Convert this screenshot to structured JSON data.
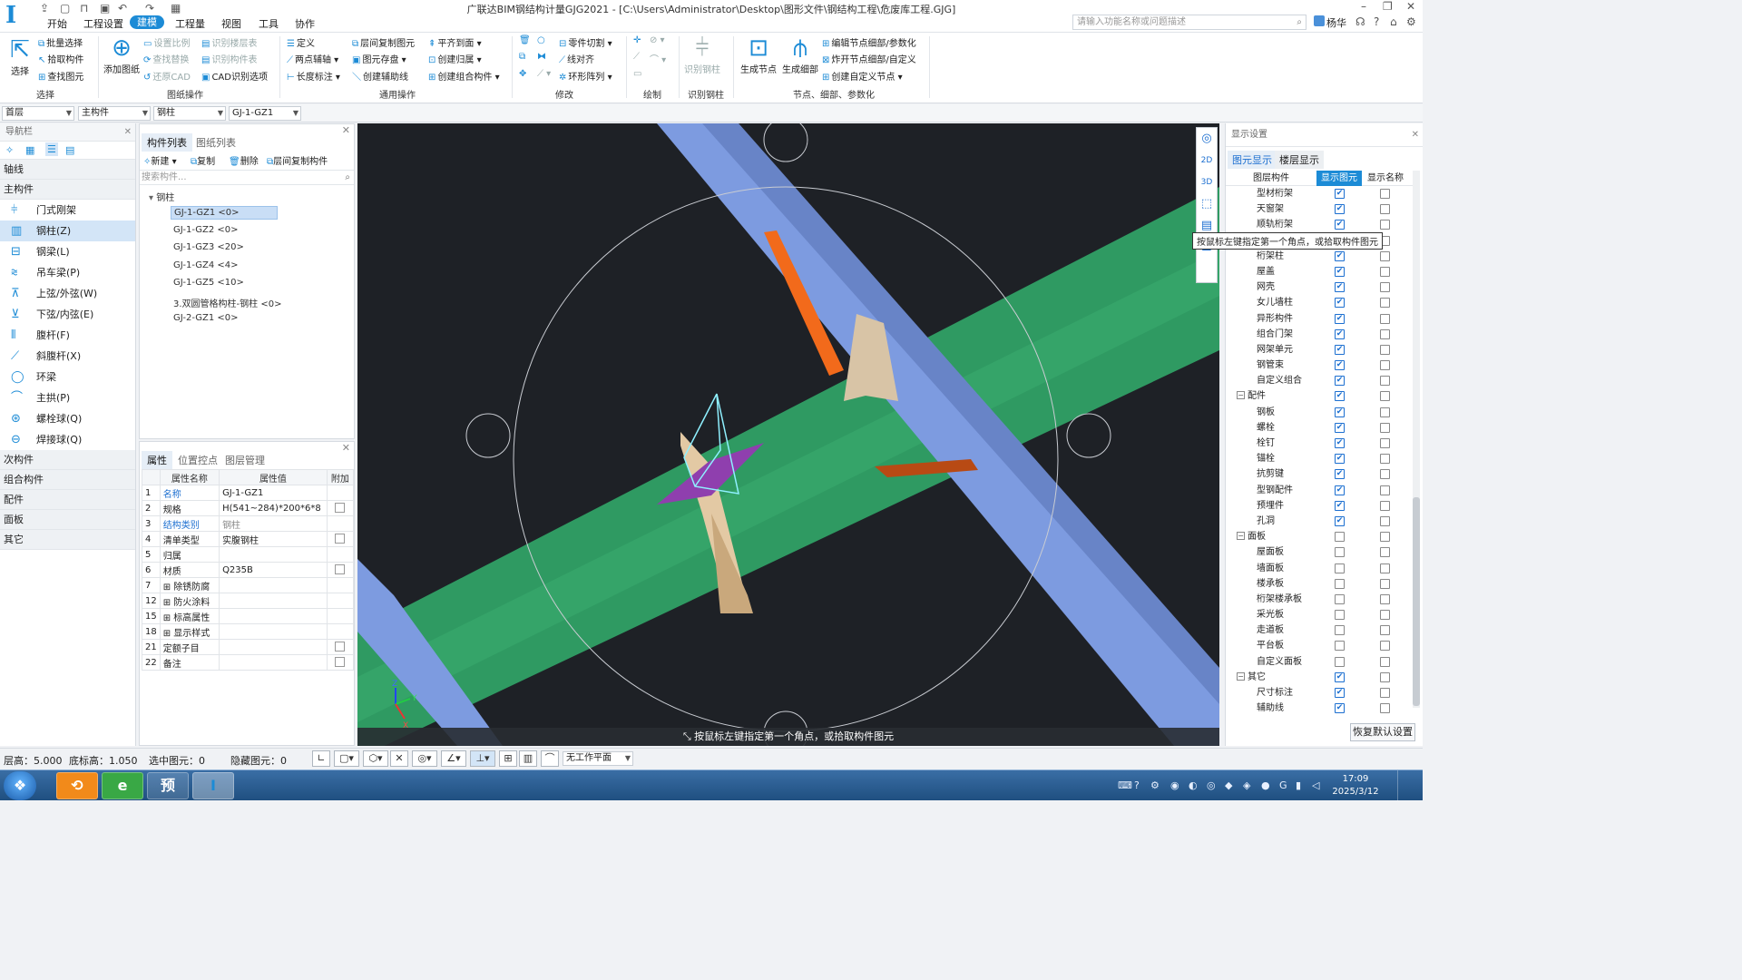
{
  "window": {
    "title": "广联达BIM钢结构计量GJG2021 - [C:\\Users\\Administrator\\Desktop\\图形文件\\钢结构工程\\危废库工程.GJG]",
    "user": "杨华"
  },
  "menu": [
    "开始",
    "工程设置",
    "建模",
    "工程量",
    "视图",
    "工具",
    "协作"
  ],
  "search": {
    "placeholder": "请输入功能名称或问题描述"
  },
  "ribbon": {
    "select": {
      "select": "选择",
      "batch_select": "批量选择",
      "pick": "拾取构件",
      "find": "查找图元",
      "group": "选择"
    },
    "drawing": {
      "add_drawing": "添加图纸",
      "set_scale": "设置比例",
      "find_replace": "查找替换",
      "restore_cad": "还原CAD",
      "recognize_floor": "识别楼层表",
      "recognize_table": "识别构件表",
      "cad_options": "CAD识别选项",
      "group": "图纸操作"
    },
    "common": {
      "define": "定义",
      "two_point_axis": "两点辅轴",
      "length_mark": "长度标注",
      "copy_floor": "层间复制图元",
      "save_element": "图元存盘",
      "create_aux": "创建辅助线",
      "align_top": "平齐到面",
      "create_owner": "创建归属",
      "create_combo": "创建组合构件",
      "group": "通用操作"
    },
    "modify": {
      "cut": "零件切割",
      "align": "线对齐",
      "ring_array": "环形阵列",
      "group": "修改"
    },
    "draw": {
      "group": "绘制"
    },
    "recognize": {
      "steel_col": "识别钢柱",
      "group": "识别钢柱"
    },
    "node": {
      "gen_node": "生成节点",
      "gen_detail": "生成细部",
      "edit_node": "编辑节点细部/参数化",
      "explode": "炸开节点细部/自定义",
      "create_custom": "创建自定义节点",
      "group": "节点、细部、参数化"
    }
  },
  "selectors": [
    "首层",
    "主构件",
    "钢柱",
    "GJ-1-GZ1"
  ],
  "nav": {
    "title": "导航栏",
    "axis": "轴线",
    "main": "主构件",
    "items": [
      "门式刚架",
      "钢柱(Z)",
      "钢梁(L)",
      "吊车梁(P)",
      "上弦/外弦(W)",
      "下弦/内弦(E)",
      "腹杆(F)",
      "斜腹杆(X)",
      "环梁",
      "主拱(P)",
      "螺栓球(Q)",
      "焊接球(Q)"
    ],
    "icons": [
      "portal-frame-icon",
      "steel-column-icon",
      "steel-beam-icon",
      "crane-beam-icon",
      "upper-chord-icon",
      "lower-chord-icon",
      "web-member-icon",
      "diagonal-web-icon",
      "ring-beam-icon",
      "main-arch-icon",
      "bolt-ball-icon",
      "weld-ball-icon"
    ],
    "cats": [
      "次构件",
      "组合构件",
      "配件",
      "面板",
      "其它"
    ]
  },
  "complist": {
    "tab1": "构件列表",
    "tab2": "图纸列表",
    "new": "新建",
    "copy": "复制",
    "delete": "删除",
    "floor_copy": "层间复制构件",
    "search_placeholder": "搜索构件...",
    "root": "钢柱",
    "items": [
      "GJ-1-GZ1 <0>",
      "GJ-1-GZ2 <0>",
      "GJ-1-GZ3 <20>",
      "GJ-1-GZ4 <4>",
      "GJ-1-GZ5 <10>",
      "3.双圆管格构柱-钢柱 <0>",
      "GJ-2-GZ1 <0>"
    ]
  },
  "props": {
    "tabs": [
      "属性",
      "位置控点",
      "图层管理"
    ],
    "headers": [
      "",
      "属性名称",
      "属性值",
      "附加"
    ],
    "rows": [
      {
        "no": "1",
        "name": "名称",
        "value": "GJ-1-GZ1",
        "chk": false
      },
      {
        "no": "2",
        "name": "规格",
        "value": "H(541~284)*200*6*8",
        "chk": true
      },
      {
        "no": "3",
        "name": "结构类别",
        "value": "钢柱",
        "chk": false
      },
      {
        "no": "4",
        "name": "清单类型",
        "value": "实腹钢柱",
        "chk": true
      },
      {
        "no": "5",
        "name": "归属",
        "value": "",
        "chk": false
      },
      {
        "no": "6",
        "name": "材质",
        "value": "Q235B",
        "chk": true
      },
      {
        "no": "7",
        "name": "除锈防腐",
        "value": "",
        "chk": false
      },
      {
        "no": "12",
        "name": "防火涂料",
        "value": "",
        "chk": false
      },
      {
        "no": "15",
        "name": "标高属性",
        "value": "",
        "chk": false
      },
      {
        "no": "18",
        "name": "显示样式",
        "value": "",
        "chk": false
      },
      {
        "no": "21",
        "name": "定额子目",
        "value": "",
        "chk": true
      },
      {
        "no": "22",
        "name": "备注",
        "value": "",
        "chk": true
      }
    ]
  },
  "viewport": {
    "hint": "按鼠标左键指定第一个角点，或拾取构件图元",
    "tooltip": "按鼠标左键指定第一个角点，或拾取构件图元",
    "axis_x": "X",
    "axis_y": "Y",
    "axis_z": "Z",
    "view2d": "2D",
    "view3d": "3D"
  },
  "display": {
    "title": "显示设置",
    "tab1": "图元显示",
    "tab2": "楼层显示",
    "headers": [
      "图层构件",
      "显示图元",
      "显示名称"
    ],
    "rows": [
      {
        "name": "型材桁架",
        "g": false,
        "a": true,
        "b": false
      },
      {
        "name": "天窗架",
        "g": false,
        "a": true,
        "b": false
      },
      {
        "name": "顺轨桁架",
        "g": false,
        "a": true,
        "b": false
      },
      {
        "name": "",
        "g": false,
        "a": true,
        "b": false
      },
      {
        "name": "桁架柱",
        "g": false,
        "a": true,
        "b": false
      },
      {
        "name": "屋盖",
        "g": false,
        "a": true,
        "b": false
      },
      {
        "name": "网壳",
        "g": false,
        "a": true,
        "b": false
      },
      {
        "name": "女儿墙柱",
        "g": false,
        "a": true,
        "b": false
      },
      {
        "name": "异形构件",
        "g": false,
        "a": true,
        "b": false
      },
      {
        "name": "组合门架",
        "g": false,
        "a": true,
        "b": false
      },
      {
        "name": "网架单元",
        "g": false,
        "a": true,
        "b": false
      },
      {
        "name": "钢管束",
        "g": false,
        "a": true,
        "b": false
      },
      {
        "name": "自定义组合",
        "g": false,
        "a": true,
        "b": false
      },
      {
        "name": "配件",
        "g": true,
        "a": true,
        "b": false
      },
      {
        "name": "钢板",
        "g": false,
        "a": true,
        "b": false
      },
      {
        "name": "螺栓",
        "g": false,
        "a": true,
        "b": false
      },
      {
        "name": "栓钉",
        "g": false,
        "a": true,
        "b": false
      },
      {
        "name": "锚栓",
        "g": false,
        "a": true,
        "b": false
      },
      {
        "name": "抗剪键",
        "g": false,
        "a": true,
        "b": false
      },
      {
        "name": "型钢配件",
        "g": false,
        "a": true,
        "b": false
      },
      {
        "name": "预埋件",
        "g": false,
        "a": true,
        "b": false
      },
      {
        "name": "孔洞",
        "g": false,
        "a": true,
        "b": false
      },
      {
        "name": "面板",
        "g": true,
        "a": false,
        "b": false
      },
      {
        "name": "屋面板",
        "g": false,
        "a": false,
        "b": false
      },
      {
        "name": "墙面板",
        "g": false,
        "a": false,
        "b": false
      },
      {
        "name": "楼承板",
        "g": false,
        "a": false,
        "b": false
      },
      {
        "name": "桁架楼承板",
        "g": false,
        "a": false,
        "b": false
      },
      {
        "name": "采光板",
        "g": false,
        "a": false,
        "b": false
      },
      {
        "name": "走道板",
        "g": false,
        "a": false,
        "b": false
      },
      {
        "name": "平台板",
        "g": false,
        "a": false,
        "b": false
      },
      {
        "name": "自定义面板",
        "g": false,
        "a": false,
        "b": false
      },
      {
        "name": "其它",
        "g": true,
        "a": true,
        "b": false
      },
      {
        "name": "尺寸标注",
        "g": false,
        "a": true,
        "b": false
      },
      {
        "name": "辅助线",
        "g": false,
        "a": true,
        "b": false
      }
    ],
    "restore": "恢复默认设置"
  },
  "status": {
    "floor_height": "层高：5.000",
    "bottom_elev": "底标高：1.050",
    "selected": "选中图元：0",
    "hidden": "隐藏图元：0",
    "workplane": "无工作平面"
  },
  "taskbar": {
    "time": "17:09",
    "date": "2025/3/12",
    "app2": "预",
    "app3": "I"
  },
  "colors": {
    "accent": "#1c8bd6",
    "green_plate": "#2e9e63",
    "blue_beam": "#7d9be0",
    "orange": "#f26a1b"
  }
}
